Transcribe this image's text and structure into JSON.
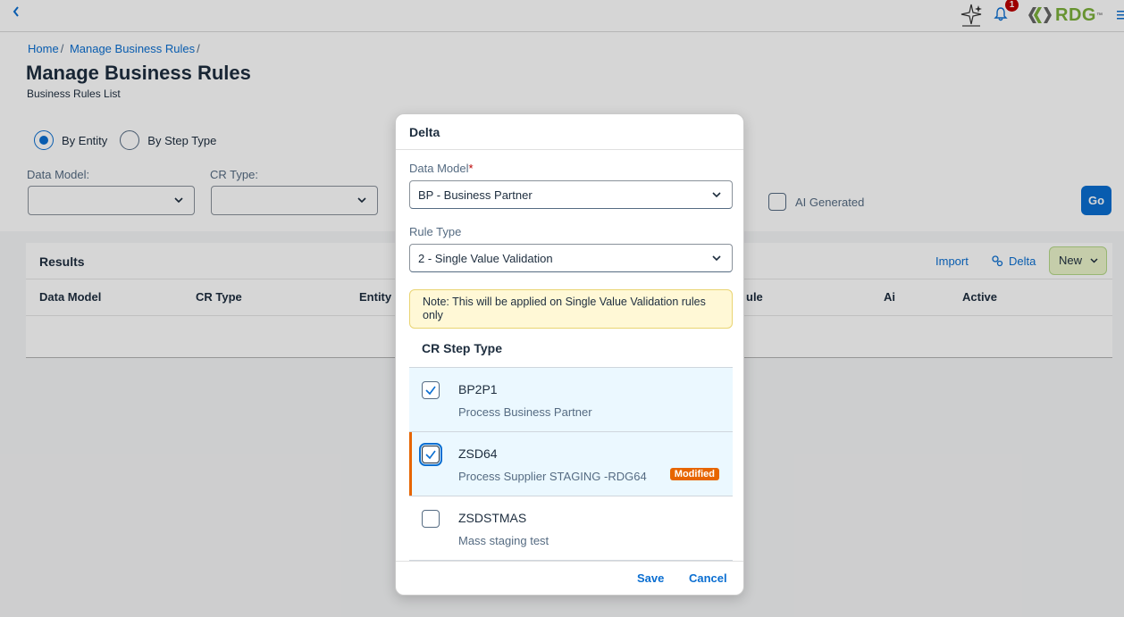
{
  "shell": {
    "notification_count": "1",
    "logo_text": "RDG",
    "logo_tm": "™"
  },
  "breadcrumb": {
    "home": "Home",
    "current": "Manage Business Rules",
    "separator": "/"
  },
  "page": {
    "title": "Manage Business Rules",
    "subtitle": "Business Rules List"
  },
  "filters": {
    "radio_entity": "By Entity",
    "radio_step": "By Step Type",
    "data_model_label": "Data Model:",
    "cr_type_label": "CR Type:",
    "ai_generated_label": "AI Generated",
    "go_label": "Go"
  },
  "results": {
    "title": "Results",
    "import_label": "Import",
    "delta_label": "Delta",
    "new_label": "New",
    "columns": [
      "Data Model",
      "CR Type",
      "Entity",
      "ule",
      "Ai",
      "Active"
    ]
  },
  "dialog": {
    "title": "Delta",
    "data_model_label": "Data Model",
    "required_mark": "*",
    "data_model_value": "BP - Business Partner",
    "rule_type_label": "Rule Type",
    "rule_type_value": "2 - Single Value Validation",
    "note": "Note: This will be applied on Single Value Validation rules only",
    "step_type_title": "CR Step Type",
    "items": [
      {
        "code": "BP2P1",
        "desc": "Process Business Partner",
        "checked": true
      },
      {
        "code": "ZSD64",
        "desc": "Process Supplier STAGING -RDG64",
        "checked": true,
        "badge": "Modified"
      },
      {
        "code": "ZSDSTMAS",
        "desc": "Mass staging test",
        "checked": false
      }
    ],
    "save_label": "Save",
    "cancel_label": "Cancel"
  },
  "colors": {
    "accent": "#0a6ed1",
    "modified": "#e76500",
    "brand_green": "#7bb03a",
    "note_bg": "#fff8d6"
  }
}
